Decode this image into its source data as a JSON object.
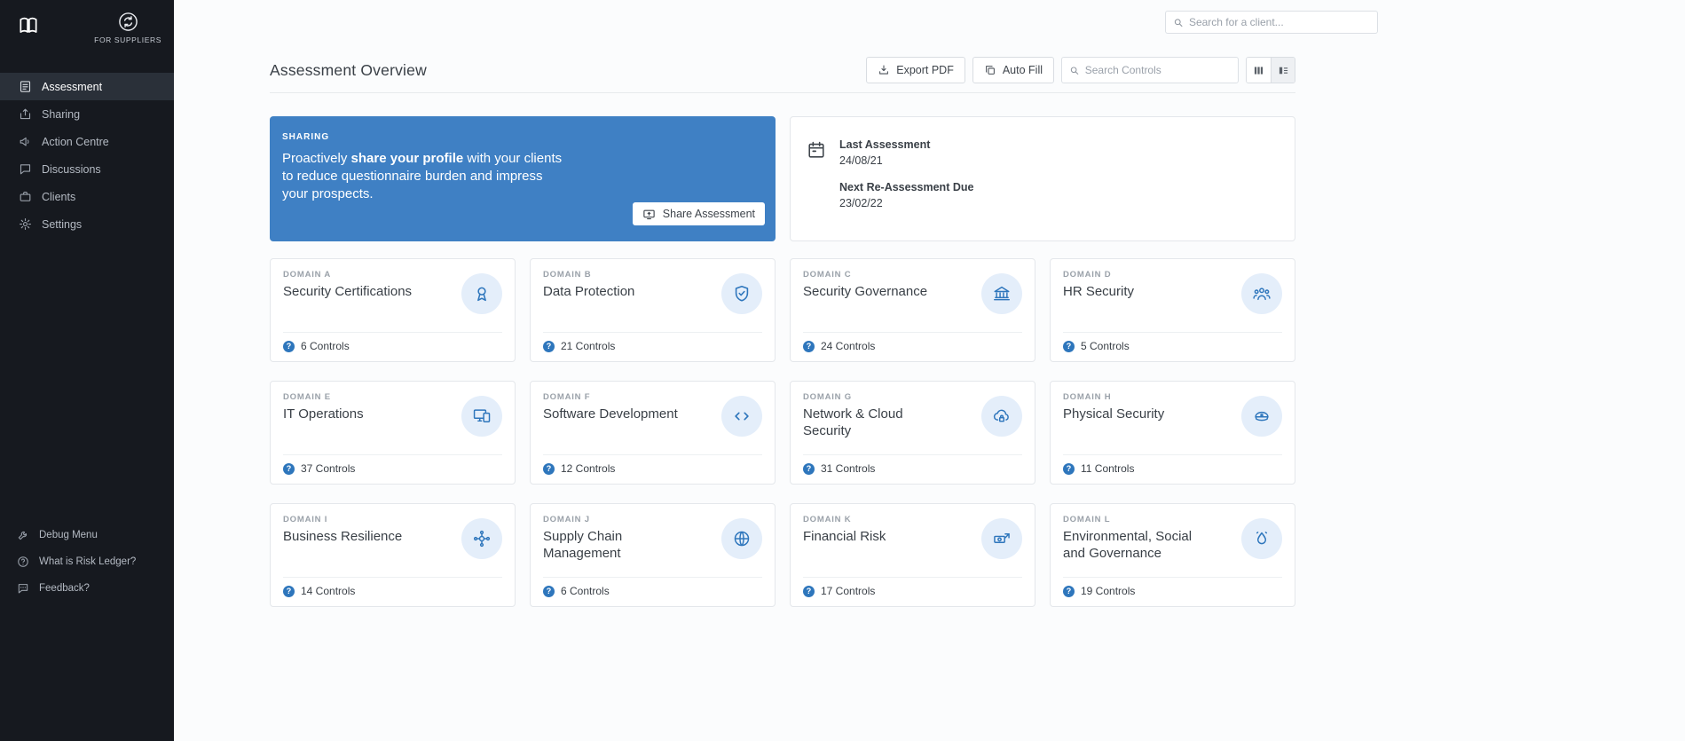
{
  "colors": {
    "accent": "#2e76bc",
    "banner_blue": "#3f80c4",
    "sidebar_bg": "#16191f",
    "icon_circle_bg": "#e4eefa"
  },
  "icons": {
    "help_glyph": "?"
  },
  "sidebar": {
    "brand_tagline": "FOR SUPPLIERS",
    "items": [
      {
        "label": "Assessment",
        "icon": "document-icon",
        "active": true
      },
      {
        "label": "Sharing",
        "icon": "share-icon",
        "active": false
      },
      {
        "label": "Action Centre",
        "icon": "megaphone-icon",
        "active": false
      },
      {
        "label": "Discussions",
        "icon": "chat-icon",
        "active": false
      },
      {
        "label": "Clients",
        "icon": "briefcase-icon",
        "active": false
      },
      {
        "label": "Settings",
        "icon": "gear-icon",
        "active": false
      }
    ],
    "footer_items": [
      {
        "label": "Debug Menu",
        "icon": "wrench-icon"
      },
      {
        "label": "What is Risk Ledger?",
        "icon": "help-circle-icon"
      },
      {
        "label": "Feedback?",
        "icon": "feedback-bubble-icon"
      }
    ]
  },
  "topbar": {
    "client_search_placeholder": "Search for a client..."
  },
  "header": {
    "title": "Assessment Overview",
    "export_pdf": "Export PDF",
    "auto_fill": "Auto Fill",
    "controls_search_placeholder": "Search Controls"
  },
  "sharing": {
    "eyebrow": "SHARING",
    "text_prefix": "Proactively ",
    "text_bold": "share your profile",
    "text_suffix": " with your clients to reduce questionnaire burden and impress your prospects.",
    "share_button": "Share Assessment"
  },
  "assessment_dates": {
    "last_label": "Last Assessment",
    "last_value": "24/08/21",
    "next_label": "Next Re-Assessment Due",
    "next_value": "23/02/22"
  },
  "domains": [
    {
      "code": "DOMAIN A",
      "title": "Security Certifications",
      "controls": "6 Controls",
      "icon": "medal-icon"
    },
    {
      "code": "DOMAIN B",
      "title": "Data Protection",
      "controls": "21 Controls",
      "icon": "shield-check-icon"
    },
    {
      "code": "DOMAIN C",
      "title": "Security Governance",
      "controls": "24 Controls",
      "icon": "bank-icon"
    },
    {
      "code": "DOMAIN D",
      "title": "HR Security",
      "controls": "5 Controls",
      "icon": "people-icon"
    },
    {
      "code": "DOMAIN E",
      "title": "IT Operations",
      "controls": "37 Controls",
      "icon": "devices-icon"
    },
    {
      "code": "DOMAIN F",
      "title": "Software Development",
      "controls": "12 Controls",
      "icon": "code-icon"
    },
    {
      "code": "DOMAIN G",
      "title": "Network & Cloud Security",
      "controls": "31 Controls",
      "icon": "cloud-icon"
    },
    {
      "code": "DOMAIN H",
      "title": "Physical Security",
      "controls": "11 Controls",
      "icon": "guard-cap-icon"
    },
    {
      "code": "DOMAIN I",
      "title": "Business Resilience",
      "controls": "14 Controls",
      "icon": "org-network-icon"
    },
    {
      "code": "DOMAIN J",
      "title": "Supply Chain Management",
      "controls": "6 Controls",
      "icon": "globe-icon"
    },
    {
      "code": "DOMAIN K",
      "title": "Financial Risk",
      "controls": "17 Controls",
      "icon": "money-transfer-icon"
    },
    {
      "code": "DOMAIN L",
      "title": "Environmental, Social and Governance",
      "controls": "19 Controls",
      "icon": "eco-drop-icon"
    }
  ]
}
